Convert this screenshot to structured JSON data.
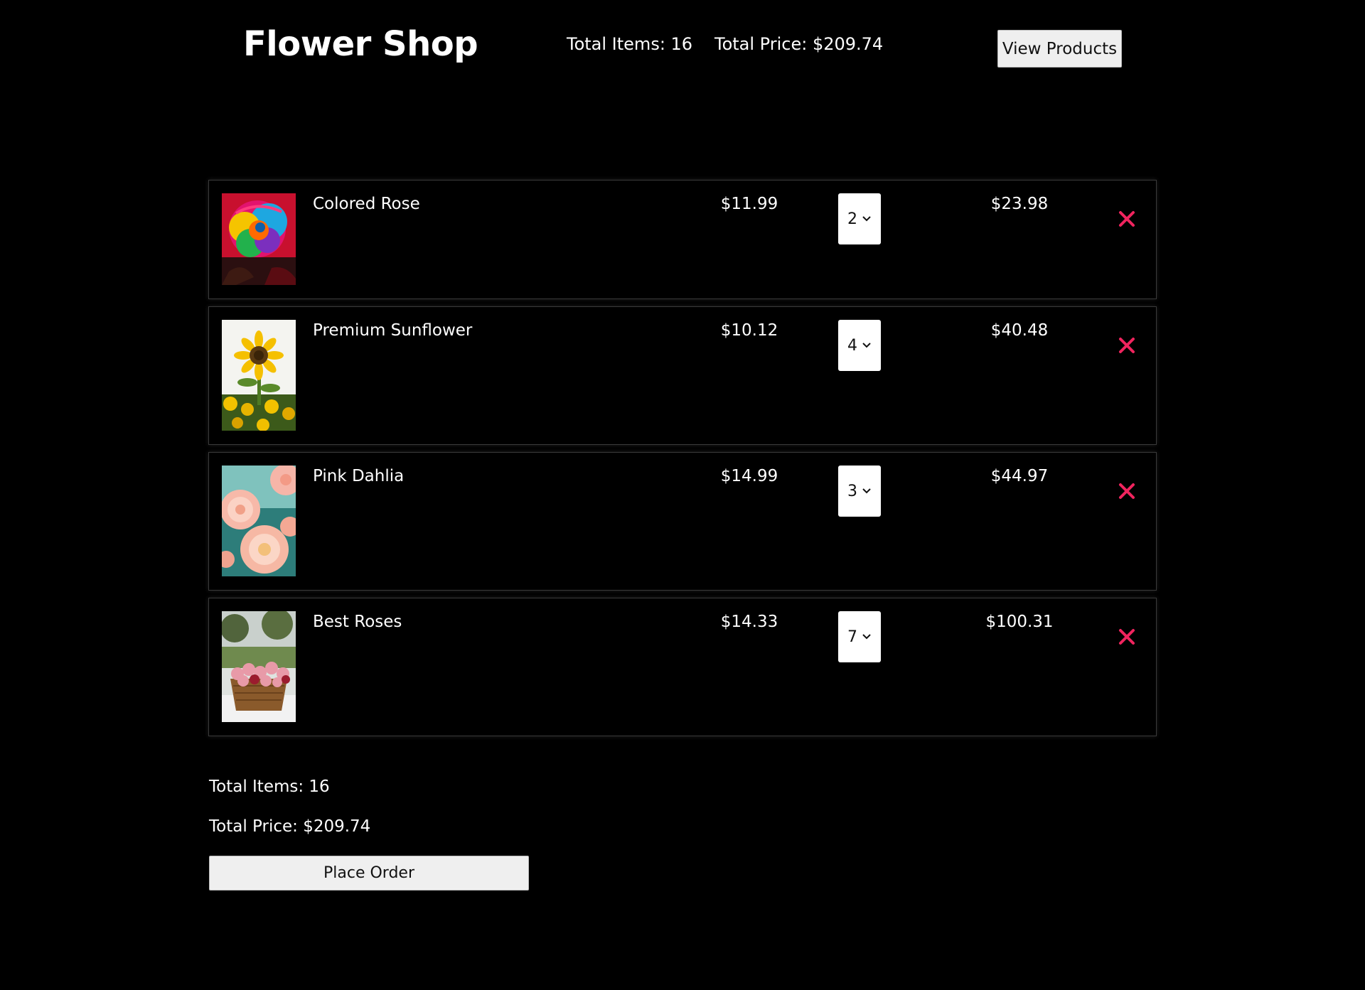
{
  "header": {
    "title": "Flower Shop",
    "total_items": "Total Items: 16",
    "total_price": "Total Price: $209.74",
    "view_products_label": "View Products"
  },
  "cart": {
    "items": [
      {
        "name": "Colored Rose",
        "price": "$11.99",
        "quantity": "2",
        "subtotal": "$23.98",
        "image": "rainbow-rose-photo"
      },
      {
        "name": "Premium Sunflower",
        "price": "$10.12",
        "quantity": "4",
        "subtotal": "$40.48",
        "image": "sunflower-photo"
      },
      {
        "name": "Pink Dahlia",
        "price": "$14.99",
        "quantity": "3",
        "subtotal": "$44.97",
        "image": "pink-dahlia-photo"
      },
      {
        "name": "Best Roses",
        "price": "$14.33",
        "quantity": "7",
        "subtotal": "$100.31",
        "image": "rose-basket-photo"
      }
    ],
    "remove_icon": "close-icon"
  },
  "summary": {
    "total_items": "Total Items: 16",
    "total_price": "Total Price: $209.74",
    "place_order_label": "Place Order"
  },
  "colors": {
    "background": "#000000",
    "text": "#ffffff",
    "remove_accent": "#f0245e",
    "button_bg": "#efefef"
  }
}
